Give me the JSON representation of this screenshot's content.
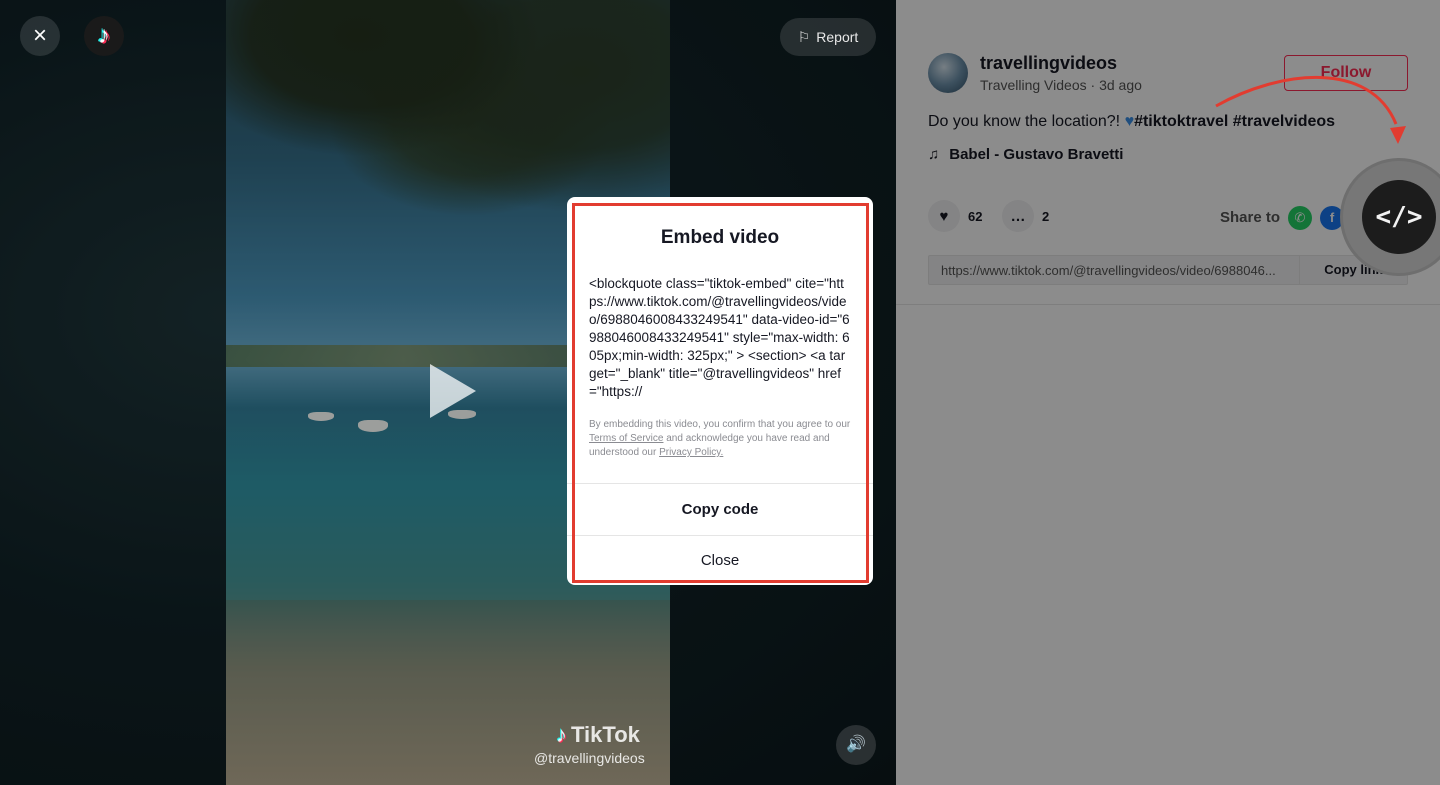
{
  "viewer": {
    "close_icon": "×",
    "report_label": "Report",
    "watermark_brand": "TikTok",
    "watermark_handle": "@travellingvideos"
  },
  "post": {
    "username": "travellingvideos",
    "display_name": "Travelling Videos",
    "time_ago": "3d ago",
    "follow_label": "Follow",
    "caption_text": "Do you know the location?! ",
    "caption_tags": "#tiktoktravel #travelvideos",
    "music": "Babel - Gustavo Bravetti",
    "likes": "62",
    "comments": "2",
    "share_label": "Share to",
    "link_url": "https://www.tiktok.com/@travellingvideos/video/6988046...",
    "copy_link_label": "Copy link",
    "embed_icon_glyph": "</>"
  },
  "modal": {
    "title": "Embed video",
    "code": "<blockquote class=\"tiktok-embed\" cite=\"https://www.tiktok.com/@travellingvideos/video/6988046008433249541\" data-video-id=\"6988046008433249541\" style=\"max-width: 605px;min-width: 325px;\" > <section> <a target=\"_blank\" title=\"@travellingvideos\" href=\"https://",
    "disclaimer_1": "By embedding this video, you confirm that you agree to our ",
    "terms_link": "Terms of Service",
    "disclaimer_2": " and acknowledge you have read and understood our ",
    "privacy_link": "Privacy Policy.",
    "copy_code_label": "Copy code",
    "close_label": "Close"
  },
  "colors": {
    "accent": "#fe2c55",
    "highlight": "#e23c30",
    "whatsapp": "#25d366",
    "facebook": "#1877f2"
  }
}
